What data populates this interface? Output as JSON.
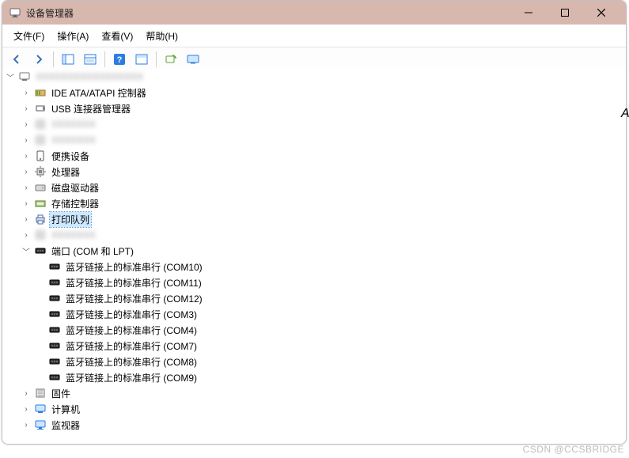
{
  "window": {
    "title": "设备管理器"
  },
  "menu": {
    "file": "文件(F)",
    "action": "操作(A)",
    "view": "查看(V)",
    "help": "帮助(H)"
  },
  "toolbar": {
    "back": "back-icon",
    "forward": "forward-icon",
    "properties": "properties-icon",
    "console": "console-icon",
    "help": "help-icon",
    "panel": "panel-icon",
    "scan": "scan-icon",
    "monitor": "monitor-icon"
  },
  "tree": {
    "root": {
      "label": "",
      "expanded": true,
      "blurred": true
    },
    "categories": [
      {
        "label": "IDE ATA/ATAPI 控制器",
        "expanded": false,
        "icon": "ide"
      },
      {
        "label": "USB 连接器管理器",
        "expanded": false,
        "icon": "usb",
        "blurred_after": true
      },
      {
        "label": "",
        "expanded": false,
        "icon": "",
        "blurred": true
      },
      {
        "label": "",
        "expanded": false,
        "icon": "",
        "blurred": true
      },
      {
        "label": "便携设备",
        "expanded": false,
        "icon": "portable"
      },
      {
        "label": "处理器",
        "expanded": false,
        "icon": "cpu"
      },
      {
        "label": "磁盘驱动器",
        "expanded": false,
        "icon": "disk"
      },
      {
        "label": "存储控制器",
        "expanded": false,
        "icon": "storage"
      },
      {
        "label": "打印队列",
        "expanded": false,
        "icon": "printer",
        "selected": true
      },
      {
        "label": "",
        "expanded": false,
        "icon": "",
        "blurred": true
      },
      {
        "label": "端口 (COM 和 LPT)",
        "expanded": true,
        "icon": "port",
        "children": [
          {
            "label": "蓝牙链接上的标准串行 (COM10)"
          },
          {
            "label": "蓝牙链接上的标准串行 (COM11)"
          },
          {
            "label": "蓝牙链接上的标准串行 (COM12)"
          },
          {
            "label": "蓝牙链接上的标准串行 (COM3)"
          },
          {
            "label": "蓝牙链接上的标准串行 (COM4)"
          },
          {
            "label": "蓝牙链接上的标准串行 (COM7)"
          },
          {
            "label": "蓝牙链接上的标准串行 (COM8)"
          },
          {
            "label": "蓝牙链接上的标准串行 (COM9)"
          }
        ]
      },
      {
        "label": "固件",
        "expanded": false,
        "icon": "firmware"
      },
      {
        "label": "计算机",
        "expanded": false,
        "icon": "computer"
      },
      {
        "label": "监视器",
        "expanded": false,
        "icon": "monitor"
      }
    ]
  },
  "watermark": "CSDN @CCSBRIDGE",
  "side_hint": "A"
}
